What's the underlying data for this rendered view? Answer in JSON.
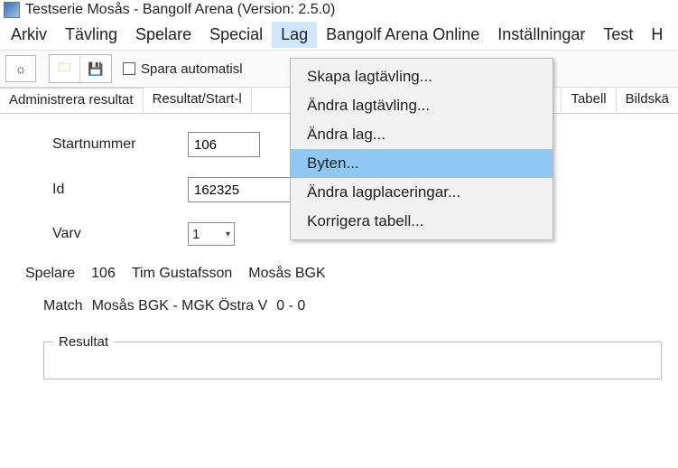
{
  "title": "Testserie Mosås - Bangolf Arena (Version: 2.5.0)",
  "menubar": [
    "Arkiv",
    "Tävling",
    "Spelare",
    "Special",
    "Lag",
    "Bangolf Arena Online",
    "Inställningar",
    "Test",
    "H"
  ],
  "menubar_open_index": 4,
  "toolbar": {
    "autosave_label": "Spara automatisl"
  },
  "tabs": {
    "left": [
      "Administrera resultat",
      "Resultat/Start-l"
    ],
    "right": [
      "Tabell",
      "Bildskä"
    ]
  },
  "dropdown": {
    "items": [
      "Skapa lagtävling...",
      "Ändra lagtävling...",
      "Ändra lag...",
      "Byten...",
      "Ändra lagplaceringar...",
      "Korrigera tabell..."
    ],
    "highlight_index": 3
  },
  "form": {
    "startnummer_label": "Startnummer",
    "startnummer_value": "106",
    "id_label": "Id",
    "id_value": "162325",
    "varv_label": "Varv",
    "varv_value": "1"
  },
  "player": {
    "label": "Spelare",
    "number": "106",
    "name": "Tim Gustafsson",
    "club": "Mosås BGK"
  },
  "match": {
    "label": "Match",
    "teams": "Mosås BGK - MGK Östra V",
    "score": "0 - 0"
  },
  "result_section": {
    "title": "Resultat"
  }
}
